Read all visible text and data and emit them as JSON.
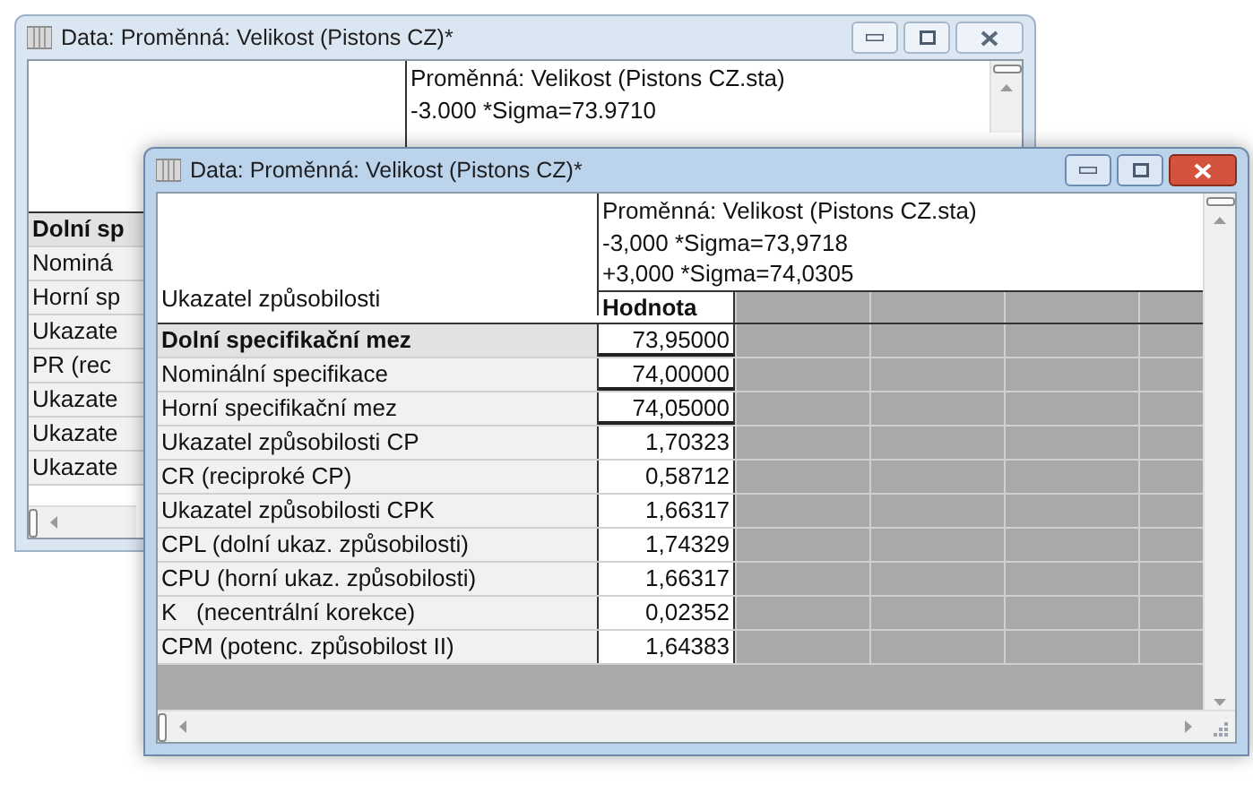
{
  "windows": [
    {
      "title": "Data: Proměnná: Velikost (Pistons CZ)*",
      "active": false,
      "header_lines": [
        "Proměnná: Velikost (Pistons CZ.sta)",
        "-3.000 *Sigma=73.9710"
      ],
      "rows": [
        {
          "label": "Dolní sp",
          "bold": true
        },
        {
          "label": "Nominá",
          "bold": false
        },
        {
          "label": "Horní sp",
          "bold": false
        },
        {
          "label": "Ukazate",
          "bold": false
        },
        {
          "label": "PR (rec",
          "bold": false
        },
        {
          "label": "Ukazate",
          "bold": false
        },
        {
          "label": "Ukazate",
          "bold": false
        },
        {
          "label": "Ukazate",
          "bold": false
        }
      ]
    },
    {
      "title": "Data: Proměnná: Velikost (Pistons CZ)*",
      "active": true,
      "header_lines": [
        "Proměnná: Velikost (Pistons CZ.sta)",
        "-3,000 *Sigma=73,9718",
        "+3,000 *Sigma=74,0305"
      ],
      "column_header": "Ukazatel způsobilosti",
      "value_header": "Hodnota",
      "rows": [
        {
          "label": "Dolní specifikační mez",
          "value": "73,95000",
          "bold": true
        },
        {
          "label": "Nominální specifikace",
          "value": "74,00000",
          "bold": false
        },
        {
          "label": "Horní specifikační mez",
          "value": "74,05000",
          "bold": false
        },
        {
          "label": "Ukazatel způsobilosti CP",
          "value": "1,70323",
          "bold": false
        },
        {
          "label": "CR (reciproké CP)",
          "value": "0,58712",
          "bold": false
        },
        {
          "label": "Ukazatel způsobilosti CPK",
          "value": "1,66317",
          "bold": false
        },
        {
          "label": "CPL (dolní ukaz. způsobilosti)",
          "value": "1,74329",
          "bold": false
        },
        {
          "label": "CPU (horní ukaz. způsobilosti)",
          "value": "1,66317",
          "bold": false
        },
        {
          "label": "K   (necentrální korekce)",
          "value": "0,02352",
          "bold": false
        },
        {
          "label": "CPM (potenc. způsobilost II)",
          "value": "1,64383",
          "bold": false
        }
      ]
    }
  ]
}
